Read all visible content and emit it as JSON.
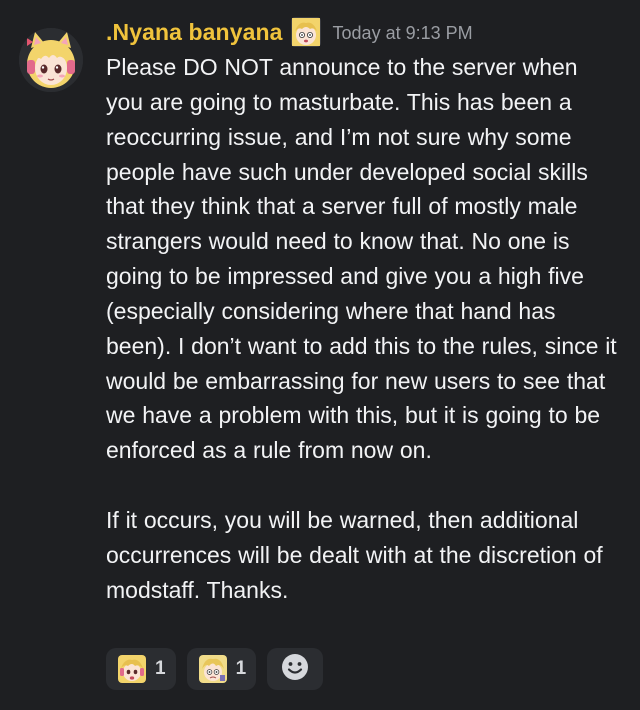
{
  "message": {
    "author": {
      "display_name": ".Nyana banyana",
      "name_color": "#f0c33c",
      "avatar_icon": "anime-catgirl-avatar-icon",
      "role_icon": "anime-emoji-role-icon"
    },
    "timestamp": "Today at 9:13 PM",
    "paragraphs": [
      "Please DO NOT announce to the server when you are going to masturbate. This has been a reoccurring issue, and I’m not sure why some people have such under developed social skills that they think that a server full of mostly male strangers would need to know that. No one is going to be impressed and give you a high five (especially considering where that hand has been). I don’t want to add this to the rules, since it would be embarrassing for new users to see that we have a problem with this, but it is going to be enforced as a rule from now on.",
      "If it occurs, you will be warned, then additional occurrences will be dealt with at the discretion of modstaff. Thanks."
    ],
    "reactions": [
      {
        "emoji": "anime-girl-emoji-icon",
        "count": "1"
      },
      {
        "emoji": "anime-girl-blonde-emoji-icon",
        "count": "1"
      }
    ],
    "add_reaction_icon": "add-reaction-smiley-icon"
  },
  "colors": {
    "background": "#1e1f22",
    "text": "#f2f3f5",
    "muted": "#9a9da3",
    "pill": "#2b2d31"
  }
}
